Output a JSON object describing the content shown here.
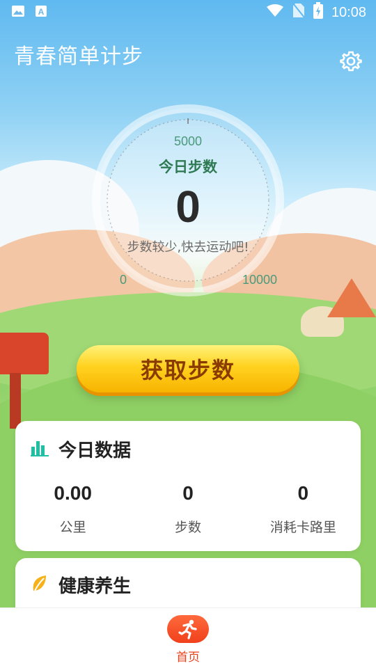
{
  "status_bar": {
    "time": "10:08",
    "icons": [
      "image-icon",
      "a-icon",
      "wifi-icon",
      "no-sim-icon",
      "battery-charging-icon"
    ]
  },
  "app_bar": {
    "title": "青春简单计步",
    "settings_icon": "gear-icon"
  },
  "gauge": {
    "mid_mark": "5000",
    "label": "今日步数",
    "value": "0",
    "hint": "步数较少,快去运动吧!",
    "min_label": "0",
    "max_label": "10000"
  },
  "primary_button": {
    "label": "获取步数"
  },
  "today_card": {
    "title": "今日数据",
    "icon": "bar-chart-icon",
    "stats": [
      {
        "value": "0.00",
        "label": "公里"
      },
      {
        "value": "0",
        "label": "步数"
      },
      {
        "value": "0",
        "label": "消耗卡路里"
      }
    ]
  },
  "health_card": {
    "title": "健康养生",
    "icon": "leaf-icon"
  },
  "bottom_nav": {
    "items": [
      {
        "label": "首页",
        "icon": "running-man-icon",
        "active": true
      }
    ]
  },
  "colors": {
    "sky": "#5fb9f0",
    "accent_orange": "#f0401c",
    "button_yellow": "#ffd21f",
    "gauge_green": "#2f7a53",
    "chart_teal": "#1fbfa2"
  }
}
